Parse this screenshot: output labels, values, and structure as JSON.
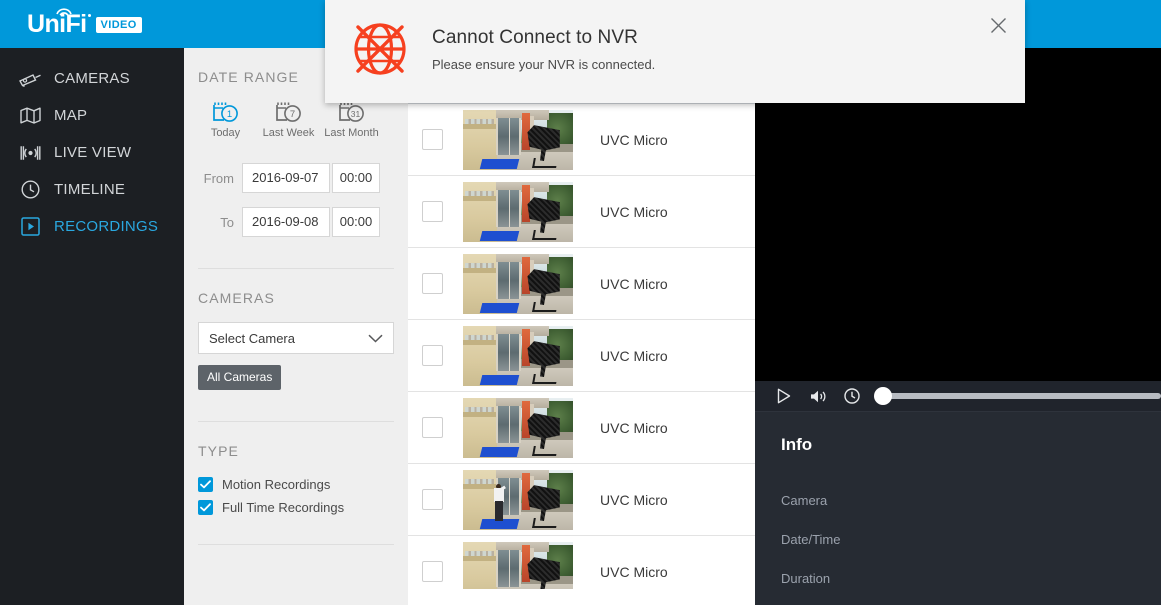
{
  "app": {
    "brand_primary": "UniFi",
    "brand_badge": "VIDEO",
    "accent_color": "#0098da",
    "sidebar_bg": "#1c1f23"
  },
  "sidebar": {
    "items": [
      {
        "label": "CAMERAS",
        "icon": "camera-icon",
        "active": false
      },
      {
        "label": "MAP",
        "icon": "map-icon",
        "active": false
      },
      {
        "label": "LIVE VIEW",
        "icon": "broadcast-icon",
        "active": false
      },
      {
        "label": "TIMELINE",
        "icon": "clock-icon",
        "active": false
      },
      {
        "label": "RECORDINGS",
        "icon": "play-box-icon",
        "active": true
      }
    ]
  },
  "filters": {
    "date_range": {
      "title": "DATE RANGE",
      "presets": [
        {
          "label": "Today",
          "badge": "1",
          "active": true
        },
        {
          "label": "Last Week",
          "badge": "7",
          "active": false
        },
        {
          "label": "Last Month",
          "badge": "31",
          "active": false
        }
      ],
      "from_label": "From",
      "from_date": "2016-09-07",
      "from_time": "00:00",
      "to_label": "To",
      "to_date": "2016-09-08",
      "to_time": "00:00"
    },
    "cameras": {
      "title": "CAMERAS",
      "select_value": "Select Camera",
      "all_cameras_label": "All Cameras"
    },
    "type": {
      "title": "TYPE",
      "options": [
        {
          "label": "Motion Recordings",
          "checked": true
        },
        {
          "label": "Full Time Recordings",
          "checked": true
        }
      ]
    }
  },
  "recordings": {
    "rows": [
      {
        "name": "UVC Micro",
        "checked": true,
        "selected": true,
        "has_person": false
      },
      {
        "name": "UVC Micro",
        "checked": false,
        "selected": false,
        "has_person": false
      },
      {
        "name": "UVC Micro",
        "checked": false,
        "selected": false,
        "has_person": false
      },
      {
        "name": "UVC Micro",
        "checked": false,
        "selected": false,
        "has_person": false
      },
      {
        "name": "UVC Micro",
        "checked": false,
        "selected": false,
        "has_person": false
      },
      {
        "name": "UVC Micro",
        "checked": false,
        "selected": false,
        "has_person": false
      },
      {
        "name": "UVC Micro",
        "checked": false,
        "selected": false,
        "has_person": true
      },
      {
        "name": "UVC Micro",
        "checked": false,
        "selected": false,
        "has_person": false
      }
    ]
  },
  "player": {
    "play_icon": "play-icon",
    "volume_icon": "volume-icon",
    "clock_icon": "clock-icon",
    "seek_position_percent": 0
  },
  "info": {
    "title": "Info",
    "fields": [
      {
        "label": "Camera",
        "value": ""
      },
      {
        "label": "Date/Time",
        "value": ""
      },
      {
        "label": "Duration",
        "value": ""
      }
    ]
  },
  "dialog": {
    "title": "Cannot Connect to NVR",
    "message": "Please ensure your NVR is connected.",
    "icon": "globe-disconnected-icon",
    "icon_color": "#f6401f",
    "close_icon": "close-icon"
  }
}
